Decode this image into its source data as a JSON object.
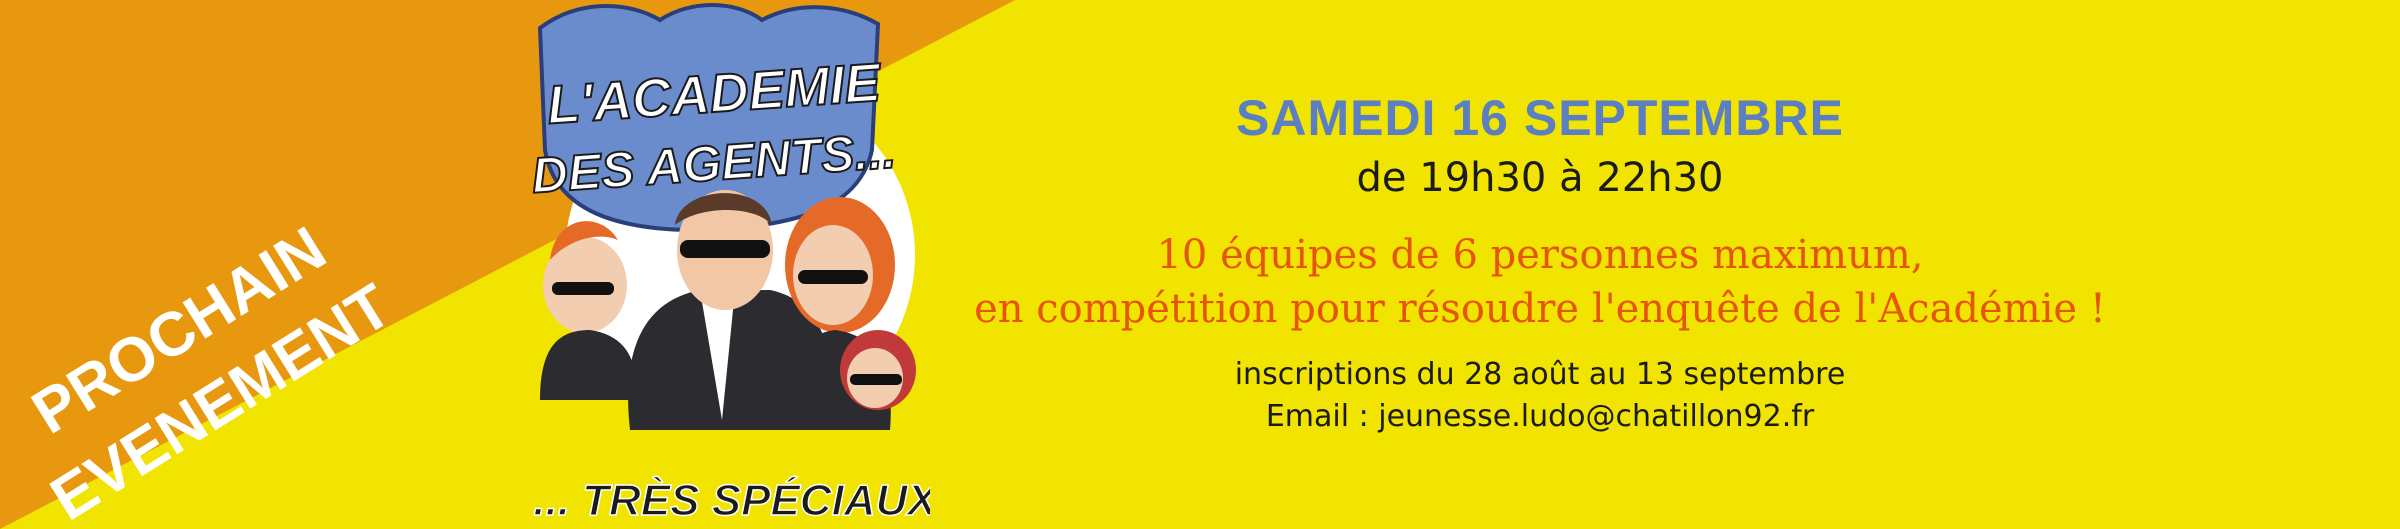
{
  "colors": {
    "yellow": "#f0e400",
    "orange": "#e8980e",
    "blue": "#5b7fc0",
    "dark": "#1b1b1b",
    "accent": "#e6550e"
  },
  "ribbon": {
    "line1": "PROCHAIN",
    "line2": "EVENEMENT"
  },
  "logo": {
    "title_line1": "L'ACADEMIE",
    "title_line2": "DES AGENTS...",
    "subtitle": "... TRÈS SPÉCIAUX"
  },
  "event": {
    "date": "SAMEDI 16 SEPTEMBRE",
    "hours": "de 19h30 à 22h30",
    "teams_line1": "10 équipes de 6 personnes maximum,",
    "teams_line2": "en compétition pour résoudre l'enquête de l'Académie !",
    "registration": "inscriptions du 28 août au 13 septembre",
    "email": "Email : jeunesse.ludo@chatillon92.fr"
  }
}
